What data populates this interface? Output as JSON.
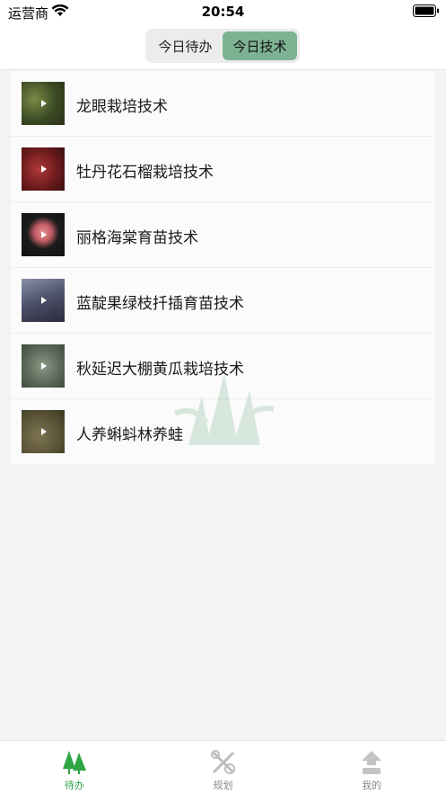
{
  "status_bar": {
    "carrier": "运营商",
    "time": "20:54"
  },
  "header": {
    "segments": [
      {
        "label": "今日待办",
        "active": false
      },
      {
        "label": "今日技术",
        "active": true
      }
    ]
  },
  "list": {
    "items": [
      {
        "title": "龙眼栽培技术",
        "thumb_color": "#4a5a2e",
        "icon": "play-icon"
      },
      {
        "title": "牡丹花石榴栽培技术",
        "thumb_color": "#7a1f1f",
        "icon": "play-icon"
      },
      {
        "title": "丽格海棠育苗技术",
        "thumb_color": "#1e1e1e",
        "icon": "play-icon"
      },
      {
        "title": "蓝靛果绿枝扦插育苗技术",
        "thumb_color": "#4a4f66",
        "icon": "play-icon"
      },
      {
        "title": "秋延迟大棚黄瓜栽培技术",
        "thumb_color": "#5d6b5a",
        "icon": "play-icon"
      },
      {
        "title": "人养蝌蚪林养蛙",
        "thumb_color": "#5b5437",
        "icon": "play-icon"
      }
    ]
  },
  "tab_bar": {
    "tabs": [
      {
        "label": "待办",
        "icon": "tree-icon",
        "active": true
      },
      {
        "label": "规划",
        "icon": "tools-icon",
        "active": false
      },
      {
        "label": "我的",
        "icon": "upload-person-icon",
        "active": false
      }
    ]
  },
  "colors": {
    "accent": "#2fa646",
    "segment_active": "#7db392"
  }
}
